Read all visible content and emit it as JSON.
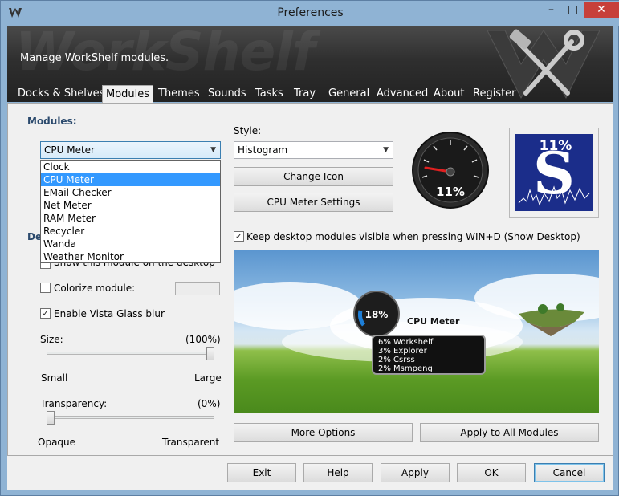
{
  "window": {
    "title": "Preferences"
  },
  "banner": {
    "description": "Manage WorkShelf modules.",
    "bg_text": "WorkShelf"
  },
  "tabs": [
    {
      "label": "Docks & Shelves"
    },
    {
      "label": "Modules"
    },
    {
      "label": "Themes"
    },
    {
      "label": "Sounds"
    },
    {
      "label": "Tasks"
    },
    {
      "label": "Tray"
    },
    {
      "label": "General"
    },
    {
      "label": "Advanced"
    },
    {
      "label": "About"
    },
    {
      "label": "Register"
    }
  ],
  "modules": {
    "group_label": "Modules:",
    "selected": "CPU Meter",
    "options": [
      "Clock",
      "CPU Meter",
      "EMail Checker",
      "Net Meter",
      "RAM Meter",
      "Recycler",
      "Wanda",
      "Weather Monitor"
    ]
  },
  "desktop": {
    "group_label": "De",
    "show_label": "Show this module on the desktop",
    "colorize_label": "Colorize module:",
    "colorize_checked": false,
    "vista_label": "Enable Vista Glass blur",
    "vista_checked": true
  },
  "size": {
    "label": "Size:",
    "value_text": "(100%)",
    "value": 100,
    "min_label": "Small",
    "max_label": "Large"
  },
  "transparency": {
    "label": "Transparency:",
    "value_text": "(0%)",
    "value": 0,
    "min_label": "Opaque",
    "max_label": "Transparent"
  },
  "style": {
    "label": "Style:",
    "selected": "Histogram",
    "change_icon": "Change Icon",
    "settings": "CPU Meter Settings"
  },
  "gauge_thumb": {
    "value_text": "11%"
  },
  "s_thumb": {
    "value_text": "11%",
    "letter": "S"
  },
  "keep_visible": {
    "label": "Keep desktop modules visible when pressing WIN+D (Show Desktop)",
    "checked": true
  },
  "preview": {
    "meter_value": "18%",
    "meter_title": "CPU Meter",
    "processes": [
      "6% Workshelf",
      "3% Explorer",
      "2% Csrss",
      "2% Msmpeng"
    ]
  },
  "buttons": {
    "more_options": "More Options",
    "apply_all": "Apply to All Modules",
    "exit": "Exit",
    "help": "Help",
    "apply": "Apply",
    "ok": "OK",
    "cancel": "Cancel"
  },
  "colors": {
    "accent": "#3399ff",
    "banner": "#2f2f2f",
    "chrome": "#8fb3d4"
  }
}
